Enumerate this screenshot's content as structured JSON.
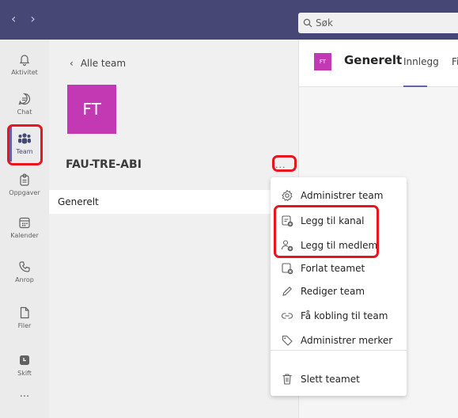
{
  "topbar": {
    "back_glyph": "‹",
    "forward_glyph": "›",
    "search_placeholder": "Søk"
  },
  "rail": {
    "items": [
      {
        "label": "Aktivitet",
        "icon": "bell-icon"
      },
      {
        "label": "Chat",
        "icon": "chat-icon"
      },
      {
        "label": "Team",
        "icon": "teams-icon"
      },
      {
        "label": "Oppgaver",
        "icon": "assignments-icon"
      },
      {
        "label": "Kalender",
        "icon": "calendar-icon"
      },
      {
        "label": "Anrop",
        "icon": "phone-icon"
      },
      {
        "label": "Filer",
        "icon": "file-icon"
      },
      {
        "label": "Skift",
        "icon": "shifts-icon"
      }
    ],
    "more_label": "...",
    "active": "Team"
  },
  "team_panel": {
    "back_label": "Alle team",
    "avatar_initials": "FT",
    "team_name": "FAU-TRE-ABI",
    "more_label": "...",
    "channels": [
      "Generelt"
    ]
  },
  "content": {
    "channel_avatar": "FT",
    "channel_title": "Generelt",
    "tabs": [
      "Innlegg",
      "Filer"
    ]
  },
  "menu": {
    "items": [
      {
        "label": "Administrer team",
        "icon": "gear-icon"
      },
      {
        "label": "Legg til kanal",
        "icon": "add-channel-icon"
      },
      {
        "label": "Legg til medlem",
        "icon": "add-member-icon"
      },
      {
        "label": "Forlat teamet",
        "icon": "leave-icon"
      },
      {
        "label": "Rediger team",
        "icon": "pencil-icon"
      },
      {
        "label": "Få kobling til team",
        "icon": "link-icon"
      },
      {
        "label": "Administrer merker",
        "icon": "tag-icon"
      },
      {
        "label": "Slett teamet",
        "icon": "trash-icon"
      }
    ]
  },
  "colors": {
    "topbar": "#464775",
    "accent": "#6264a7",
    "avatar": "#c239b3",
    "highlight": "#e8151c"
  }
}
